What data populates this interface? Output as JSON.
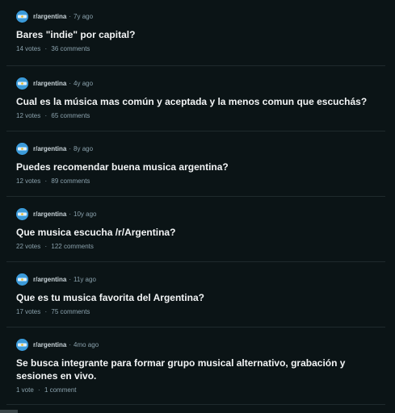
{
  "posts": [
    {
      "subreddit": "r/argentina",
      "age": "7y ago",
      "title": "Bares \"indie\" por capital?",
      "votes": "14 votes",
      "comments": "36 comments"
    },
    {
      "subreddit": "r/argentina",
      "age": "4y ago",
      "title": "Cual es la música mas común y aceptada y la menos comun que escuchás?",
      "votes": "12 votes",
      "comments": "65 comments"
    },
    {
      "subreddit": "r/argentina",
      "age": "8y ago",
      "title": "Puedes recomendar buena musica argentina?",
      "votes": "12 votes",
      "comments": "89 comments"
    },
    {
      "subreddit": "r/argentina",
      "age": "10y ago",
      "title": "Que musica escucha /r/Argentina?",
      "votes": "22 votes",
      "comments": "122 comments"
    },
    {
      "subreddit": "r/argentina",
      "age": "11y ago",
      "title": "Que es tu musica favorita del Argentina?",
      "votes": "17 votes",
      "comments": "75 comments"
    },
    {
      "subreddit": "r/argentina",
      "age": "4mo ago",
      "title": "Se busca integrante para formar grupo musical alternativo, grabación y sesiones en vivo.",
      "votes": "1 vote",
      "comments": "1 comment"
    }
  ],
  "meta": {
    "separator": "·"
  },
  "icons": {
    "avatar": "subreddit-avatar-icon"
  },
  "colors": {
    "background": "#0b1416",
    "avatar": "#3b9ad9",
    "text": "#f2f4f5",
    "muted": "#8ba2ad"
  }
}
